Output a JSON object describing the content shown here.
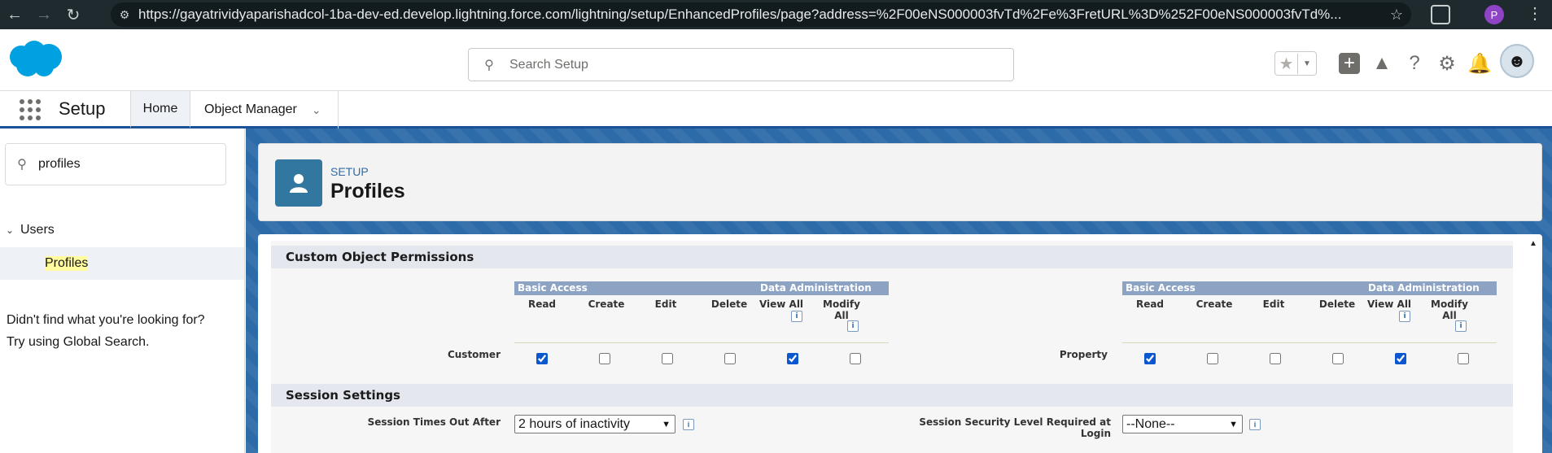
{
  "browser": {
    "url": "https://gayatrividyaparishadcol-1ba-dev-ed.develop.lightning.force.com/lightning/setup/EnhancedProfiles/page?address=%2F00eNS000003fvTd%2Fe%3FretURL%3D%252F00eNS000003fvTd%...",
    "profile_initial": "P"
  },
  "header": {
    "search_placeholder": "Search Setup"
  },
  "nav": {
    "app_name": "Setup",
    "tabs": [
      {
        "label": "Home"
      },
      {
        "label": "Object Manager"
      }
    ]
  },
  "sidebar": {
    "quick_find_value": "profiles",
    "tree": {
      "parent_label": "Users",
      "child_label": "Profiles"
    },
    "not_found_line1": "Didn't find what you're looking for?",
    "not_found_line2": "Try using Global Search."
  },
  "page_header": {
    "eyebrow": "SETUP",
    "title": "Profiles"
  },
  "custom_object_permissions": {
    "heading": "Custom Object Permissions",
    "basic_access_label": "Basic Access",
    "data_admin_label": "Data Administration",
    "columns": [
      "Read",
      "Create",
      "Edit",
      "Delete",
      "View All",
      "Modify All"
    ],
    "objects": [
      {
        "name": "Customer",
        "perms": [
          true,
          false,
          false,
          false,
          true,
          false
        ]
      },
      {
        "name": "Property",
        "perms": [
          true,
          false,
          false,
          false,
          true,
          false
        ]
      }
    ]
  },
  "session_settings": {
    "heading": "Session Settings",
    "timeout_label": "Session Times Out After",
    "timeout_value": "2 hours of inactivity",
    "security_label_line1": "Session Security Level Required at",
    "security_label_line2": "Login",
    "security_value": "--None--"
  }
}
